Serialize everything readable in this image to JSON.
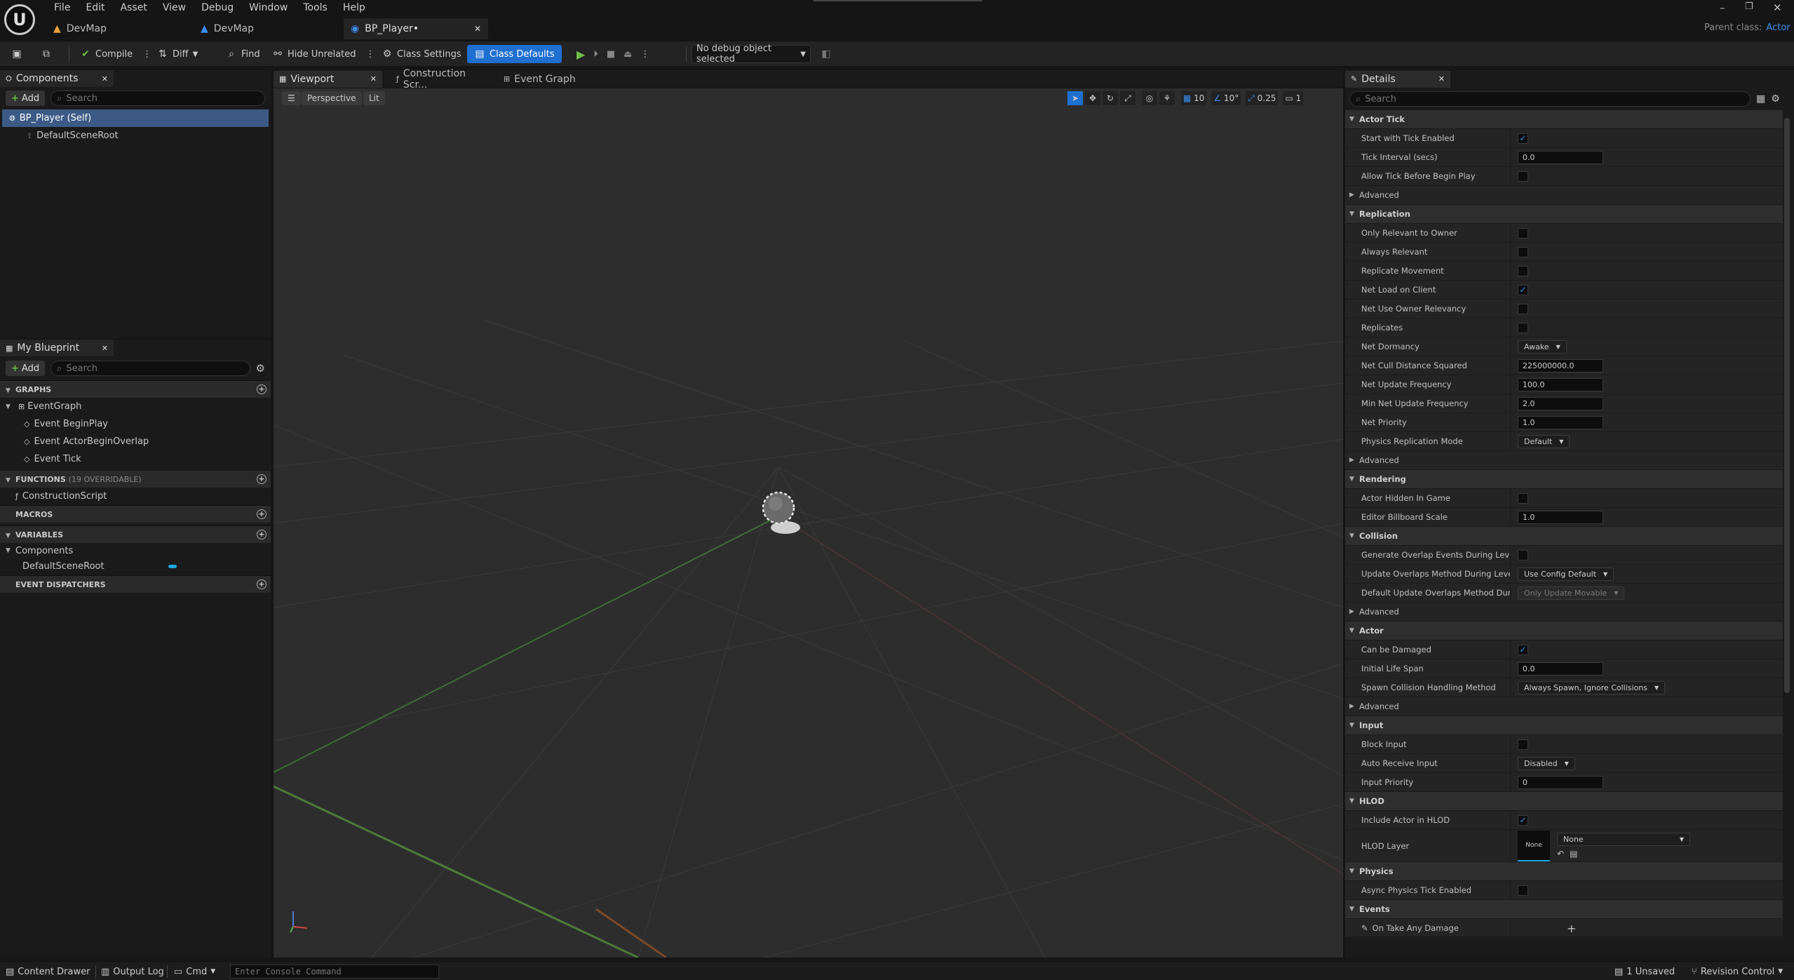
{
  "menu": [
    "File",
    "Edit",
    "Asset",
    "View",
    "Debug",
    "Window",
    "Tools",
    "Help"
  ],
  "doc_tabs": [
    {
      "label": "DevMap"
    },
    {
      "label": "DevMap"
    },
    {
      "label": "BP_Player•"
    }
  ],
  "parent_class": {
    "label": "Parent class:",
    "value": "Actor"
  },
  "toolbar": {
    "compile": "Compile",
    "diff": "Diff",
    "find": "Find",
    "hide_unrelated": "Hide Unrelated",
    "class_settings": "Class Settings",
    "class_defaults": "Class Defaults",
    "debug_object": "No debug object selected"
  },
  "components": {
    "title": "Components",
    "add": "Add",
    "search_placeholder": "Search",
    "items": [
      "BP_Player (Self)",
      "DefaultSceneRoot"
    ]
  },
  "my_blueprint": {
    "title": "My Blueprint",
    "add": "Add",
    "search_placeholder": "Search",
    "graphs_header": "GRAPHS",
    "event_graph": "EventGraph",
    "events": [
      "Event BeginPlay",
      "Event ActorBeginOverlap",
      "Event Tick"
    ],
    "functions_header": "FUNCTIONS",
    "functions_note": "(19 OVERRIDABLE)",
    "construction_script": "ConstructionScript",
    "macros_header": "MACROS",
    "variables_header": "VARIABLES",
    "components_group": "Components",
    "component_var": "DefaultSceneRoot",
    "dispatchers_header": "EVENT DISPATCHERS"
  },
  "editor_tabs": [
    "Viewport",
    "Construction Scr...",
    "Event Graph"
  ],
  "viewport": {
    "perspective": "Perspective",
    "lit": "Lit",
    "grid": "10",
    "angle": "10°",
    "scale": "0.25",
    "camera": "1"
  },
  "details": {
    "title": "Details",
    "search_placeholder": "Search",
    "sections": [
      {
        "name": "Actor Tick",
        "props": [
          {
            "label": "Start with Tick Enabled",
            "type": "check",
            "value": true
          },
          {
            "label": "Tick Interval (secs)",
            "type": "num",
            "value": "0.0"
          },
          {
            "label": "Allow Tick Before Begin Play",
            "type": "check",
            "value": false
          }
        ],
        "advanced": "Advanced"
      },
      {
        "name": "Replication",
        "props": [
          {
            "label": "Only Relevant to Owner",
            "type": "check",
            "value": false
          },
          {
            "label": "Always Relevant",
            "type": "check",
            "value": false
          },
          {
            "label": "Replicate Movement",
            "type": "check",
            "value": false
          },
          {
            "label": "Net Load on Client",
            "type": "check",
            "value": true
          },
          {
            "label": "Net Use Owner Relevancy",
            "type": "check",
            "value": false
          },
          {
            "label": "Replicates",
            "type": "check",
            "value": false
          },
          {
            "label": "Net Dormancy",
            "type": "combo",
            "value": "Awake"
          },
          {
            "label": "Net Cull Distance Squared",
            "type": "num",
            "value": "225000000.0"
          },
          {
            "label": "Net Update Frequency",
            "type": "num",
            "value": "100.0"
          },
          {
            "label": "Min Net Update Frequency",
            "type": "num",
            "value": "2.0"
          },
          {
            "label": "Net Priority",
            "type": "num",
            "value": "1.0"
          },
          {
            "label": "Physics Replication Mode",
            "type": "combo",
            "value": "Default"
          }
        ],
        "advanced": "Advanced"
      },
      {
        "name": "Rendering",
        "props": [
          {
            "label": "Actor Hidden In Game",
            "type": "check",
            "value": false
          },
          {
            "label": "Editor Billboard Scale",
            "type": "num",
            "value": "1.0"
          }
        ]
      },
      {
        "name": "Collision",
        "props": [
          {
            "label": "Generate Overlap Events During Level Stre...",
            "type": "check",
            "value": false
          },
          {
            "label": "Update Overlaps Method During Level Stre...",
            "type": "combo",
            "value": "Use Config Default"
          },
          {
            "label": "Default Update Overlaps Method During Le...",
            "type": "combo",
            "value": "Only Update Movable",
            "disabled": true
          }
        ],
        "advanced": "Advanced"
      },
      {
        "name": "Actor",
        "props": [
          {
            "label": "Can be Damaged",
            "type": "check",
            "value": true
          },
          {
            "label": "Initial Life Span",
            "type": "num",
            "value": "0.0"
          },
          {
            "label": "Spawn Collision Handling Method",
            "type": "combo",
            "value": "Always Spawn, Ignore Collisions"
          }
        ],
        "advanced": "Advanced"
      },
      {
        "name": "Input",
        "props": [
          {
            "label": "Block Input",
            "type": "check",
            "value": false
          },
          {
            "label": "Auto Receive Input",
            "type": "combo",
            "value": "Disabled"
          },
          {
            "label": "Input Priority",
            "type": "num",
            "value": "0"
          }
        ]
      },
      {
        "name": "HLOD",
        "props": [
          {
            "label": "Include Actor in HLOD",
            "type": "check",
            "value": true
          },
          {
            "label": "HLOD Layer",
            "type": "hlod",
            "value": "None",
            "thumb": "None"
          }
        ]
      },
      {
        "name": "Physics",
        "props": [
          {
            "label": "Async Physics Tick Enabled",
            "type": "check",
            "value": false
          }
        ]
      },
      {
        "name": "Events",
        "props": [
          {
            "label": "On Take Any Damage",
            "type": "event",
            "value": ""
          }
        ]
      }
    ]
  },
  "status": {
    "content_drawer": "Content Drawer",
    "output_log": "Output Log",
    "cmd": "Cmd",
    "console_placeholder": "Enter Console Command",
    "unsaved": "1 Unsaved",
    "revision_control": "Revision Control"
  },
  "colors": {
    "accent": "#1e6fd0",
    "check": "#3d8ef0",
    "selected_row": "#3c5a85"
  }
}
